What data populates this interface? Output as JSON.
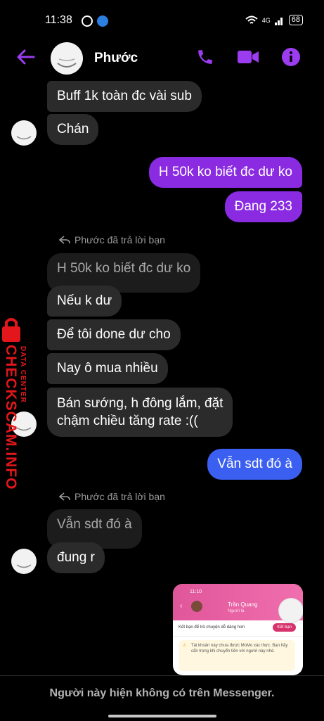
{
  "status_bar": {
    "time": "11:38",
    "network": "4G",
    "battery": "68"
  },
  "header": {
    "contact_name": "Phước"
  },
  "messages": {
    "m1": "Buff 1k toàn đc vài sub",
    "m2": "Chán",
    "m3": "H 50k ko biết đc dư ko",
    "m4": "Đang 233",
    "reply1_label": "Phước đã trả lời bạn",
    "m5_quoted": "H 50k ko biết đc dư ko",
    "m6": "Nếu k dư",
    "m7": "Để tôi done dư cho",
    "m8": "Nay ô mua nhiều",
    "m9_line1": "Bán sướng, h đông lắm, đặt",
    "m9_line2": "chậm chiều tăng rate :((",
    "m10": "Vẫn sdt đó à",
    "reply2_label": "Phước đã trả lời bạn",
    "m11_quoted": "Vẫn sdt đó à",
    "m12": "đung r"
  },
  "watermark": {
    "brand": "CHECKSCAM.INFO",
    "sub": "DATA CENTER"
  },
  "shared_image": {
    "time": "11:10",
    "contact_name": "Trần Quang",
    "contact_sub": "Người lạ",
    "prompt": "Kết bạn để trò chuyện dễ dàng hơn",
    "add_button": "Kết bạn",
    "warning": "Tài khoản này chưa được MoMo xác thực. Bạn hãy cẩn trọng khi chuyển tiền với người này nhé."
  },
  "footer": {
    "notice": "Người này hiện không có trên Messenger."
  },
  "colors": {
    "accent": "#8a2be2",
    "outgoing_blue": "#3b5ff0",
    "incoming": "#2b2b2b",
    "watermark": "#e3171b"
  }
}
